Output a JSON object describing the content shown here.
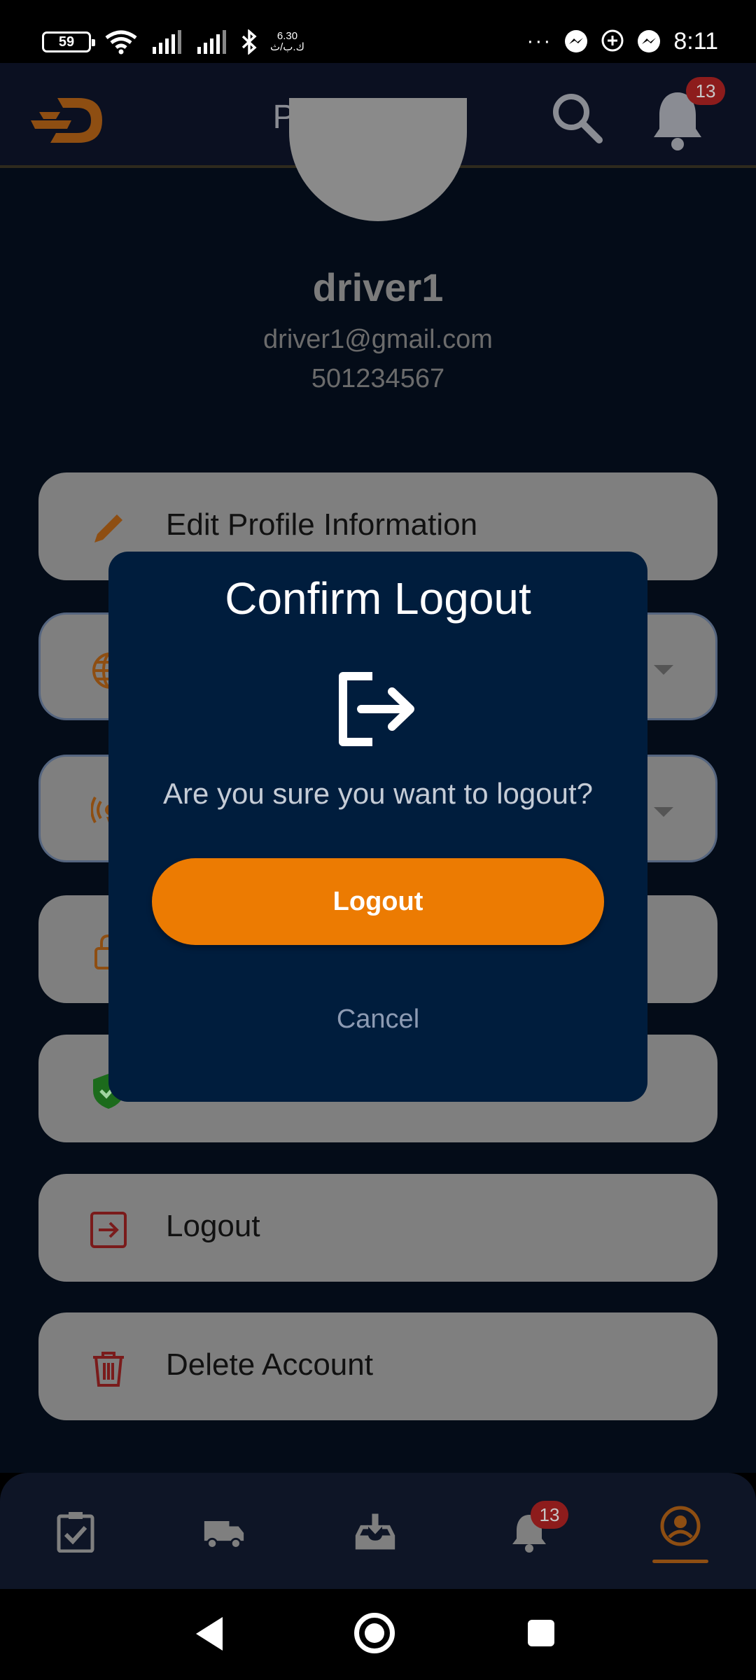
{
  "status_bar": {
    "battery": "59",
    "network_speed": "6.30",
    "network_unit": "ك.ب/ث",
    "time": "8:11",
    "more": "···"
  },
  "app_bar": {
    "title": "Profile",
    "notification_count": "13"
  },
  "profile": {
    "username": "driver1",
    "email": "driver1@gmail.com",
    "phone": "501234567"
  },
  "menu": {
    "edit_profile": "Edit Profile Information",
    "logout": "Logout",
    "delete_account": "Delete Account"
  },
  "bottom_nav": {
    "items": [
      "tasks-icon",
      "truck-icon",
      "inbox-download-icon",
      "bell-icon",
      "profile-icon"
    ],
    "notification_count": "13",
    "active_item": "profile-icon"
  },
  "dialog": {
    "title": "Confirm Logout",
    "message": "Are you sure you want to logout?",
    "confirm_label": "Logout",
    "cancel_label": "Cancel"
  },
  "colors": {
    "accent_orange": "#ec7b02",
    "dialog_bg": "#001d3d",
    "badge_red": "#8d1c1c",
    "overlay_bg": "#040c18"
  }
}
